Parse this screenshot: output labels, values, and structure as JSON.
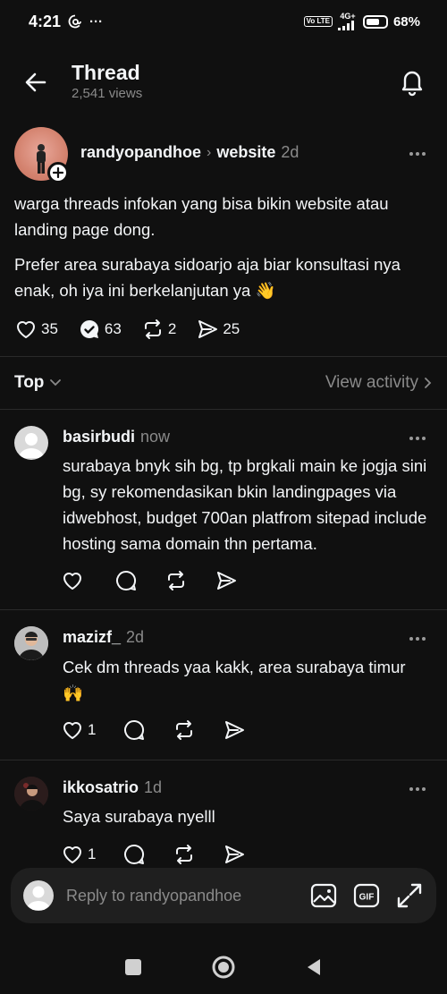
{
  "status_bar": {
    "time": "4:21",
    "network": "4G+",
    "volte": "Vo LTE",
    "battery": "68%"
  },
  "header": {
    "title": "Thread",
    "views": "2,541 views"
  },
  "post": {
    "username": "randyopandhoe",
    "separator": "›",
    "topic": "website",
    "time": "2d",
    "paragraph1": "warga threads infokan yang bisa bikin website atau landing page dong.",
    "paragraph2": "Prefer area surabaya sidoarjo aja biar konsultasi nya enak, oh iya ini berkelanjutan ya 👋",
    "likes": "35",
    "replies": "63",
    "reposts": "2",
    "shares": "25"
  },
  "sort": {
    "label": "Top",
    "view_activity": "View activity"
  },
  "replies": [
    {
      "username": "basirbudi",
      "time": "now",
      "text": "surabaya bnyk sih bg, tp brgkali main ke jogja sini bg, sy rekomendasikan bkin landingpages via idwebhost, budget 700an platfrom sitepad include hosting sama domain thn pertama.",
      "likes": ""
    },
    {
      "username": "mazizf_",
      "time": "2d",
      "text": "Cek dm threads yaa kakk, area surabaya timur 🙌",
      "likes": "1"
    },
    {
      "username": "ikkosatrio",
      "time": "1d",
      "text": "Saya surabaya nyelll",
      "likes": "1"
    }
  ],
  "composer": {
    "placeholder": "Reply to randyopandhoe"
  },
  "icons": {
    "back": "arrow-left-icon",
    "bell": "bell-icon",
    "heart": "heart-icon",
    "reply": "comment-icon",
    "repost": "repost-icon",
    "share": "send-icon",
    "image": "image-icon",
    "gif": "gif-icon",
    "expand": "expand-icon"
  },
  "colors": {
    "background": "#101010",
    "text": "#f3f5f7",
    "secondary": "#8a8a8a",
    "composer": "#1f1f1f"
  }
}
